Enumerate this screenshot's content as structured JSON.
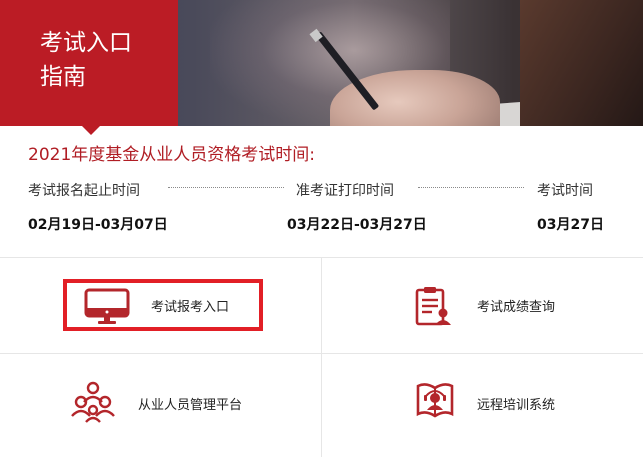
{
  "banner": {
    "title_line1": "考试入口",
    "title_line2": "指南"
  },
  "exam": {
    "heading": "2021年度基金从业人员资格考试时间:",
    "schedule": [
      {
        "label": "考试报名起止时间",
        "date": "02月19日-03月07日"
      },
      {
        "label": "准考证打印时间",
        "date": "03月22日-03月27日"
      },
      {
        "label": "考试时间",
        "date": "03月27日"
      }
    ]
  },
  "tiles": [
    {
      "label": "考试报考入口",
      "icon": "monitor-icon"
    },
    {
      "label": "考试成绩查询",
      "icon": "report-icon"
    },
    {
      "label": "从业人员管理平台",
      "icon": "people-group-icon"
    },
    {
      "label": "远程培训系统",
      "icon": "online-training-icon"
    }
  ],
  "colors": {
    "brand_red": "#bb1c25",
    "highlight_red": "#e21f26",
    "icon_red": "#b3262b"
  }
}
